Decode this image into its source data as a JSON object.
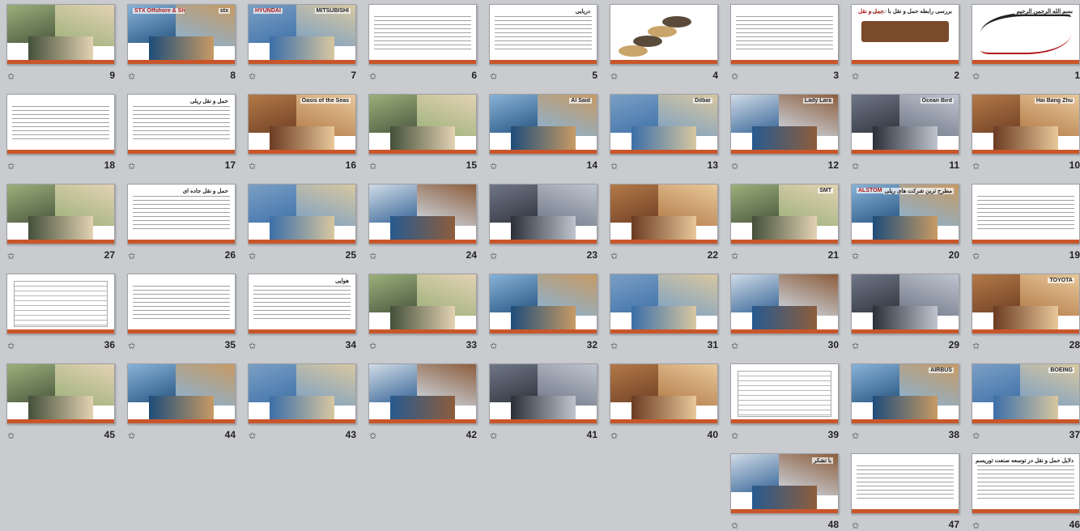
{
  "slides": [
    {
      "num": "1",
      "title": "بسم الله الرحمن الرحيم",
      "kind": "calligraphy"
    },
    {
      "num": "2",
      "title": "بررسی رابطه حمل و نقل با توریسم",
      "sub": "حمل و نقل",
      "kind": "title"
    },
    {
      "num": "3",
      "kind": "text"
    },
    {
      "num": "4",
      "kind": "diagram",
      "labels": [
        "هوایی",
        "زمینی",
        "دریایی",
        "خط آهن"
      ]
    },
    {
      "num": "5",
      "title": "دریایی",
      "kind": "text"
    },
    {
      "num": "6",
      "kind": "text"
    },
    {
      "num": "7",
      "title": "MITSUBISHI",
      "sub": "HYUNDAI",
      "kind": "photo"
    },
    {
      "num": "8",
      "title": "stx",
      "sub": "STX Offshore & Shipbuilding",
      "kind": "photo"
    },
    {
      "num": "9",
      "kind": "photo"
    },
    {
      "num": "10",
      "title": "Hai Bang Zhu",
      "kind": "photo"
    },
    {
      "num": "11",
      "title": "Ocean Bird",
      "kind": "photo"
    },
    {
      "num": "12",
      "title": "Lady Lara",
      "kind": "photo"
    },
    {
      "num": "13",
      "title": "Dilbar",
      "kind": "photo"
    },
    {
      "num": "14",
      "title": "Al Said",
      "kind": "photo"
    },
    {
      "num": "15",
      "kind": "photo"
    },
    {
      "num": "16",
      "title": "Oasis of the Seas",
      "kind": "photo"
    },
    {
      "num": "17",
      "title": "حمل و نقل ریلی",
      "kind": "text"
    },
    {
      "num": "18",
      "kind": "text"
    },
    {
      "num": "19",
      "kind": "text"
    },
    {
      "num": "20",
      "title": "مطرح ترین شرکت های ریلی",
      "sub": "ALSTOM",
      "kind": "photo"
    },
    {
      "num": "21",
      "title": "SMT",
      "kind": "photo"
    },
    {
      "num": "22",
      "kind": "photo"
    },
    {
      "num": "23",
      "kind": "photo"
    },
    {
      "num": "24",
      "kind": "photo"
    },
    {
      "num": "25",
      "kind": "photo"
    },
    {
      "num": "26",
      "title": "حمل و نقل جاده ای",
      "kind": "text"
    },
    {
      "num": "27",
      "kind": "photo"
    },
    {
      "num": "28",
      "title": "TOYOTA",
      "kind": "photo"
    },
    {
      "num": "29",
      "kind": "photo"
    },
    {
      "num": "30",
      "kind": "photo"
    },
    {
      "num": "31",
      "kind": "photo"
    },
    {
      "num": "32",
      "kind": "photo"
    },
    {
      "num": "33",
      "kind": "photo"
    },
    {
      "num": "34",
      "title": "هوایی",
      "kind": "text"
    },
    {
      "num": "35",
      "kind": "text"
    },
    {
      "num": "36",
      "kind": "table"
    },
    {
      "num": "37",
      "title": "BOEING",
      "kind": "photo"
    },
    {
      "num": "38",
      "title": "AIRBUS",
      "kind": "photo"
    },
    {
      "num": "39",
      "kind": "table"
    },
    {
      "num": "40",
      "kind": "photo"
    },
    {
      "num": "41",
      "kind": "photo"
    },
    {
      "num": "42",
      "kind": "photo"
    },
    {
      "num": "43",
      "kind": "photo"
    },
    {
      "num": "44",
      "kind": "photo"
    },
    {
      "num": "45",
      "kind": "photo"
    },
    {
      "num": "46",
      "title": "دلایل حمل و نقل در توسعه صنعت توریسم",
      "kind": "text"
    },
    {
      "num": "47",
      "kind": "text"
    },
    {
      "num": "48",
      "title": "با تشکر",
      "kind": "photo"
    }
  ],
  "colors": {
    "background": "#c9cbcf",
    "accent": "#c8562a"
  },
  "icons": {
    "slide_marker": "star-transition-icon"
  }
}
